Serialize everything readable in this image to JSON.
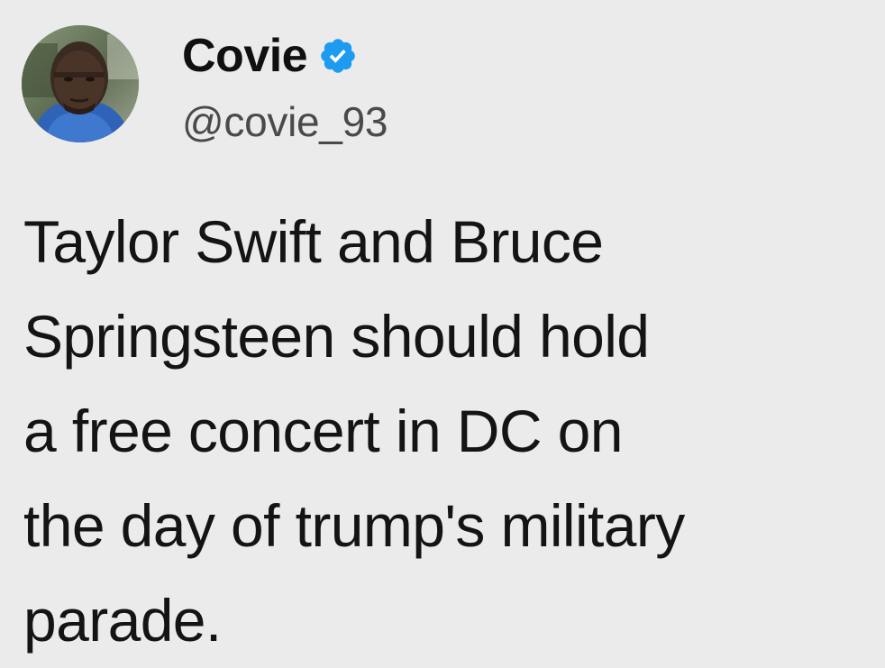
{
  "author": {
    "display_name": "Covie",
    "handle": "@covie_93",
    "verified": true,
    "verified_color": "#1d9bf0",
    "avatar_icon": "person-photo-avatar"
  },
  "tweet": {
    "text": "Taylor Swift and Bruce\nSpringsteen should hold\na free concert in DC on\nthe day of trump's military\nparade."
  },
  "colors": {
    "background": "#ebebeb",
    "text": "#141414",
    "handle": "#4a4a4a"
  }
}
